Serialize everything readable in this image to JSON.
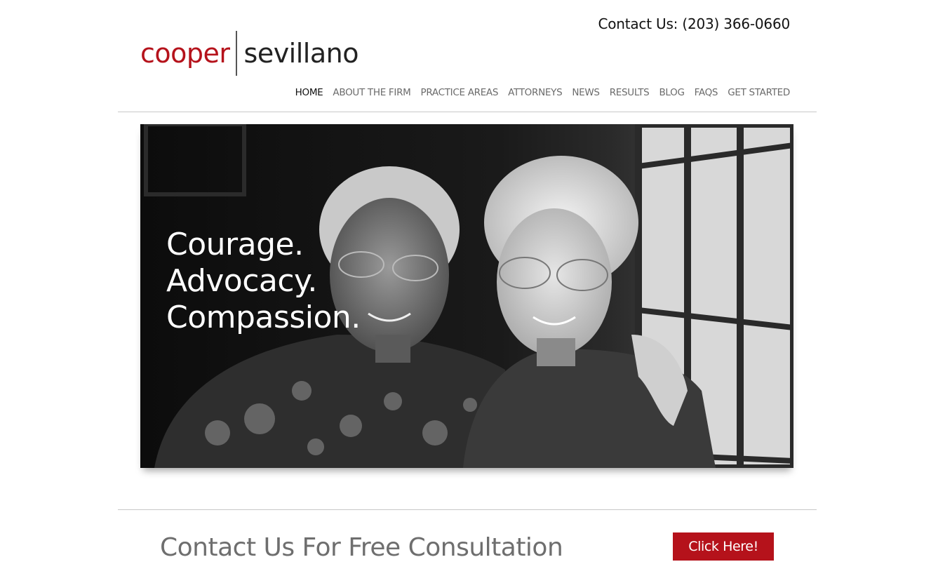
{
  "header": {
    "contact": "Contact Us: (203) 366-0660",
    "logo": {
      "left": "cooper",
      "right": "sevillano"
    }
  },
  "nav": {
    "items": [
      {
        "label": "HOME",
        "active": true
      },
      {
        "label": "ABOUT THE FIRM",
        "active": false
      },
      {
        "label": "PRACTICE AREAS",
        "active": false
      },
      {
        "label": "ATTORNEYS",
        "active": false
      },
      {
        "label": "NEWS",
        "active": false
      },
      {
        "label": "RESULTS",
        "active": false
      },
      {
        "label": "BLOG",
        "active": false
      },
      {
        "label": "FAQS",
        "active": false
      },
      {
        "label": "GET STARTED",
        "active": false
      }
    ]
  },
  "hero": {
    "lines": [
      "Courage.",
      "Advocacy.",
      "Compassion."
    ]
  },
  "cta": {
    "heading": "Contact Us For Free Consultation",
    "button": "Click Here!"
  },
  "colors": {
    "brand_red": "#b5121b",
    "nav_text": "#6b6b6b",
    "heading_gray": "#6e6e6e"
  }
}
